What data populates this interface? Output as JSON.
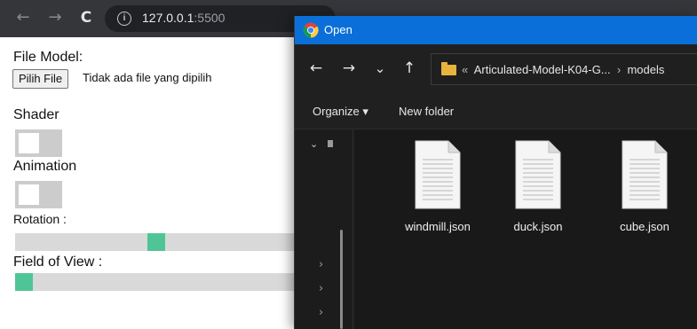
{
  "browser": {
    "back_glyph": "←",
    "forward_glyph": "→",
    "reload_glyph": "C",
    "info_glyph": "i",
    "url_host": "127.0.0.1",
    "url_port": ":5500"
  },
  "page": {
    "file_model_label": "File Model:",
    "file_button_label": "Pilih File",
    "file_status": "Tidak ada file yang dipilih",
    "shader_label": "Shader",
    "shader_on": false,
    "animation_label": "Animation",
    "animation_on": false,
    "rotation_label": "Rotation :",
    "rotation_value_fraction": 0.48,
    "fov_label": "Field of View :",
    "fov_value_fraction": 0.0
  },
  "dialog": {
    "title": "Open",
    "nav": {
      "back": "←",
      "forward": "→",
      "recent": "⌄",
      "up": "↑"
    },
    "path_prefix": "«",
    "path_parent": "Articulated-Model-K04-G...",
    "path_separator": "›",
    "path_current": "models",
    "toolbar": {
      "organize": "Organize ▾",
      "new_folder": "New folder"
    },
    "files": [
      {
        "name": "windmill.json"
      },
      {
        "name": "duck.json"
      },
      {
        "name": "cube.json"
      }
    ]
  },
  "colors": {
    "browser_bar": "#35363a",
    "dialog_title": "#0a6fd8",
    "slider_thumb": "#4fc596",
    "toggle_off": "#cccccc",
    "folder": "#e8b43d"
  }
}
